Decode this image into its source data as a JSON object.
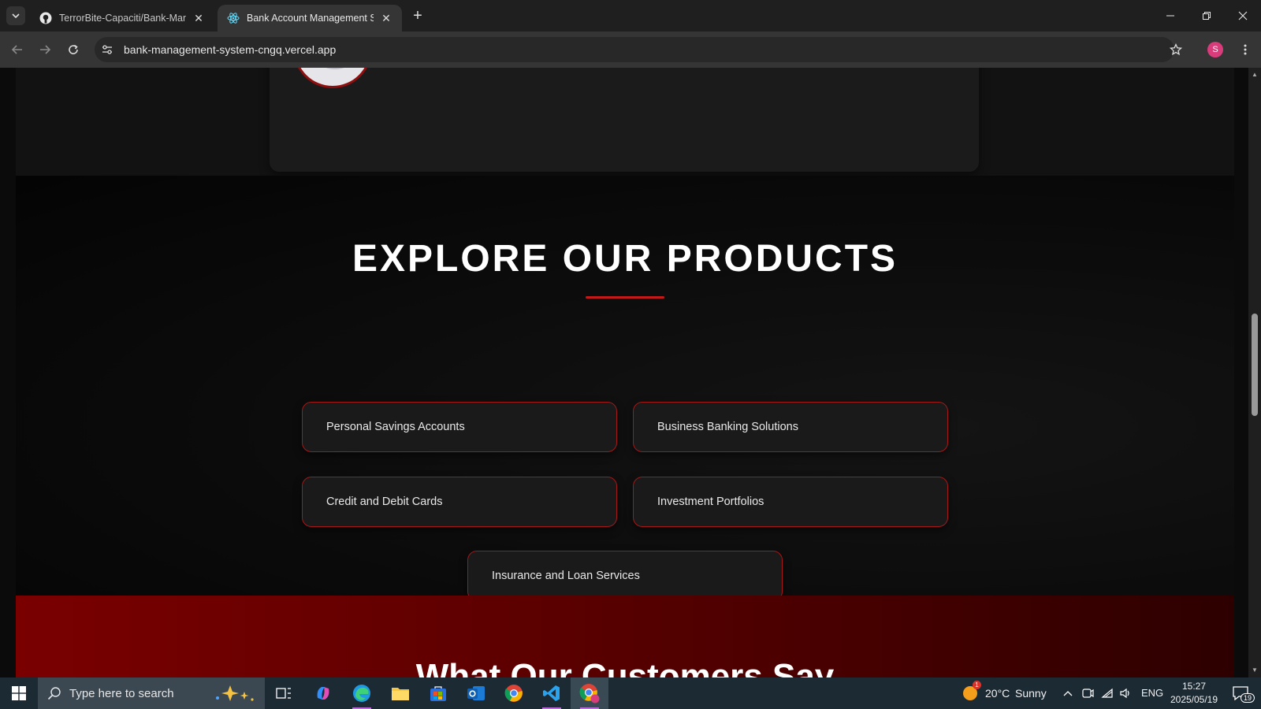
{
  "browser": {
    "tabs": [
      {
        "title": "TerrorBite-Capaciti/Bank-Manag",
        "favicon": "github-icon",
        "active": false
      },
      {
        "title": "Bank Account Management Sys",
        "favicon": "react-icon",
        "active": true
      }
    ],
    "url": "bank-management-system-cngq.vercel.app",
    "profile_initial": "S"
  },
  "page": {
    "products": {
      "title": "EXPLORE OUR PRODUCTS",
      "items": [
        "Personal Savings Accounts",
        "Business Banking Solutions",
        "Credit and Debit Cards",
        "Investment Portfolios",
        "Insurance and Loan Services"
      ]
    },
    "testimonials": {
      "title": "What Our Customers Say"
    }
  },
  "taskbar": {
    "search_placeholder": "Type here to search",
    "weather": {
      "temp": "20°C",
      "condition": "Sunny",
      "badge": "1"
    },
    "language": "ENG",
    "time": "15:27",
    "date": "2025/05/19",
    "notifications": "19",
    "apps": [
      "copilot-icon",
      "edge-icon",
      "file-explorer-icon",
      "store-icon",
      "outlook-icon",
      "chrome-icon",
      "vscode-icon",
      "chrome-profile-icon"
    ]
  },
  "colors": {
    "accent_red": "#c21a1a",
    "card_border": "#a51818",
    "page_bg": "#0b0b0b",
    "banner_red": "#7a0000"
  }
}
